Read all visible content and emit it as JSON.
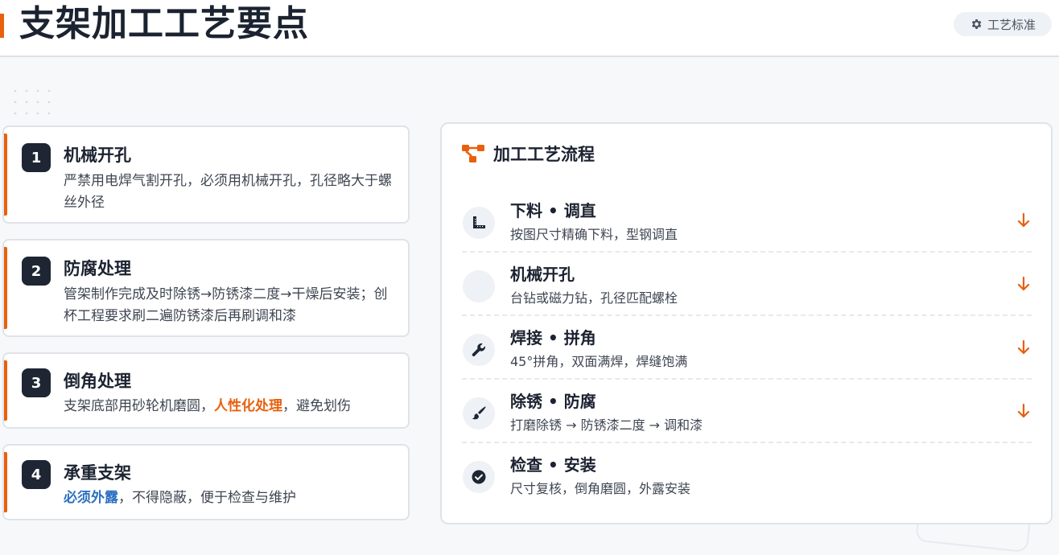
{
  "header": {
    "title": "支架加工工艺要点",
    "standard_button": "工艺标准"
  },
  "cards": [
    {
      "num": "1",
      "title": "机械开孔",
      "desc": "严禁用电焊气割开孔，必须用机械开孔，孔径略大于螺丝外径"
    },
    {
      "num": "2",
      "title": "防腐处理",
      "desc": "管架制作完成及时除锈→防锈漆二度→干燥后安装；创杯工程要求刷二遍防锈漆后再刷调和漆"
    },
    {
      "num": "3",
      "title": "倒角处理",
      "desc_a": "支架底部用砂轮机磨圆，",
      "desc_hl": "人性化处理",
      "desc_b": "，避免划伤"
    },
    {
      "num": "4",
      "title": "承重支架",
      "desc_hl": "必须外露",
      "desc_b": "，不得隐蔽，便于检查与维护"
    }
  ],
  "panel": {
    "title": "加工工艺流程",
    "steps": [
      {
        "title": "下料 • 调直",
        "desc": "按图尺寸精确下料，型钢调直",
        "icon": "ruler-icon"
      },
      {
        "title": "机械开孔",
        "desc": "台钻或磁力钻，孔径匹配螺栓",
        "icon": "blank-icon"
      },
      {
        "title": "焊接 • 拼角",
        "desc": "45°拼角，双面满焊，焊缝饱满",
        "icon": "wrench-icon"
      },
      {
        "title": "除锈 • 防腐",
        "desc": "打磨除锈 → 防锈漆二度 → 调和漆",
        "icon": "paintbrush-icon"
      },
      {
        "title": "检查 • 安装",
        "desc": "尺寸复核，倒角磨圆，外露安装",
        "icon": "check-circle-icon"
      }
    ]
  },
  "colors": {
    "accent": "#e8600e",
    "highlight_blue": "#2c6fc1",
    "dark": "#1e2634"
  }
}
